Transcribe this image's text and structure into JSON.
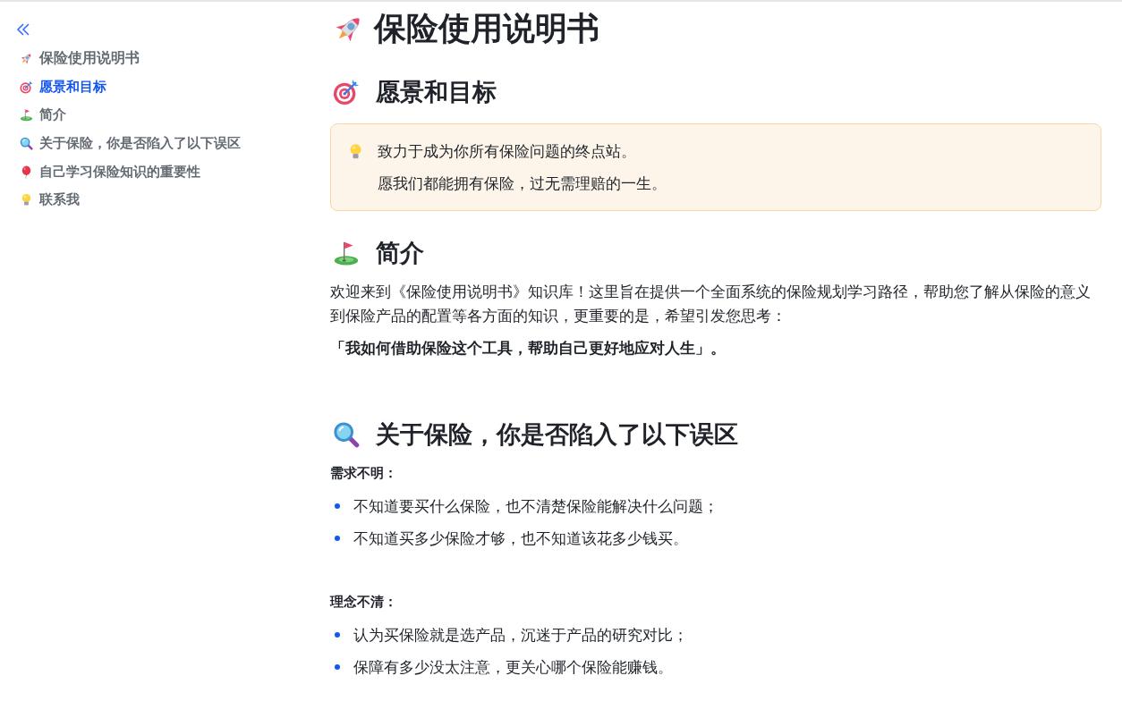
{
  "sidebar": {
    "items": [
      {
        "kind": "title",
        "label": "保险使用说明书",
        "selected": false
      },
      {
        "kind": "section",
        "label": "愿景和目标",
        "selected": true
      },
      {
        "kind": "section",
        "label": "简介",
        "selected": false
      },
      {
        "kind": "section",
        "label": "关于保险，你是否陷入了以下误区",
        "selected": false
      },
      {
        "kind": "section",
        "label": "自己学习保险知识的重要性",
        "selected": false
      },
      {
        "kind": "section",
        "label": "联系我",
        "selected": false
      }
    ]
  },
  "document": {
    "title": "保险使用说明书",
    "sections": [
      {
        "heading": "愿景和目标",
        "blocks": [
          {
            "kind": "callout",
            "lines": [
              "致力于成为你所有保险问题的终点站。",
              "愿我们都能拥有保险，过无需理赔的一生。"
            ]
          }
        ]
      },
      {
        "heading": "简介",
        "blocks": [
          {
            "kind": "paragraph",
            "text": "欢迎来到《保险使用说明书》知识库！这里旨在提供一个全面系统的保险规划学习路径，帮助您了解从保险的意义到保险产品的配置等各方面的知识，更重要的是，希望引发您思考："
          },
          {
            "kind": "emphasis",
            "text": "「我如何借助保险这个工具，帮助自己更好地应对人生」。"
          }
        ]
      },
      {
        "heading": "关于保险，你是否陷入了以下误区",
        "blocks": [
          {
            "kind": "label",
            "text": "需求不明："
          },
          {
            "kind": "list",
            "items": [
              "不知道要买什么保险，也不清楚保险能解决什么问题；",
              "不知道买多少保险才够，也不知道该花多少钱买。"
            ]
          },
          {
            "kind": "label",
            "text": "理念不清："
          },
          {
            "kind": "list",
            "items": [
              "认为买保险就是选产品，沉迷于产品的研究对比；",
              "保障有多少没太注意，更关心哪个保险能赚钱。"
            ]
          }
        ]
      }
    ]
  }
}
